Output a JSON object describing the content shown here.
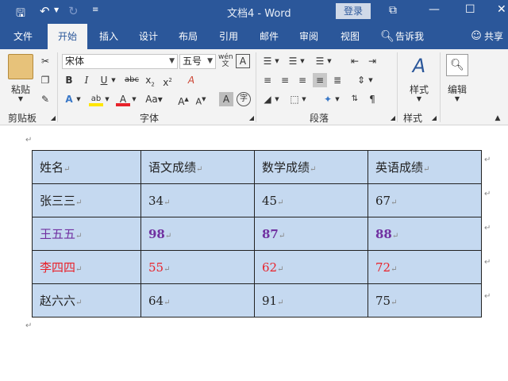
{
  "window": {
    "title": "文档4 - Word",
    "login_label": "登录"
  },
  "tabs": [
    {
      "label": "文件"
    },
    {
      "label": "开始"
    },
    {
      "label": "插入"
    },
    {
      "label": "设计"
    },
    {
      "label": "布局"
    },
    {
      "label": "引用"
    },
    {
      "label": "邮件"
    },
    {
      "label": "审阅"
    },
    {
      "label": "视图"
    }
  ],
  "tell_me": "告诉我",
  "share": "共享",
  "ribbon": {
    "clipboard": {
      "paste_label": "粘贴",
      "group_label": "剪贴板"
    },
    "font": {
      "name": "宋体",
      "size": "五号",
      "group_label": "字体"
    },
    "paragraph": {
      "group_label": "段落"
    },
    "styles": {
      "label": "样式",
      "group_label": "样式"
    },
    "editing": {
      "label": "编辑"
    }
  },
  "table": {
    "headers": [
      "姓名",
      "语文成绩",
      "数学成绩",
      "英语成绩"
    ],
    "rows": [
      {
        "name": "张三三",
        "chinese": "34",
        "math": "45",
        "english": "67",
        "style": "normal"
      },
      {
        "name": "王五五",
        "chinese": "98",
        "math": "87",
        "english": "88",
        "style": "purple"
      },
      {
        "name": "李四四",
        "chinese": "55",
        "math": "62",
        "english": "72",
        "style": "red"
      },
      {
        "name": "赵六六",
        "chinese": "64",
        "math": "91",
        "english": "75",
        "style": "normal"
      }
    ]
  },
  "colors": {
    "accent": "#2b579a",
    "table_fill": "#c5d9f0",
    "purple": "#7030a0",
    "red": "#e8232b"
  }
}
